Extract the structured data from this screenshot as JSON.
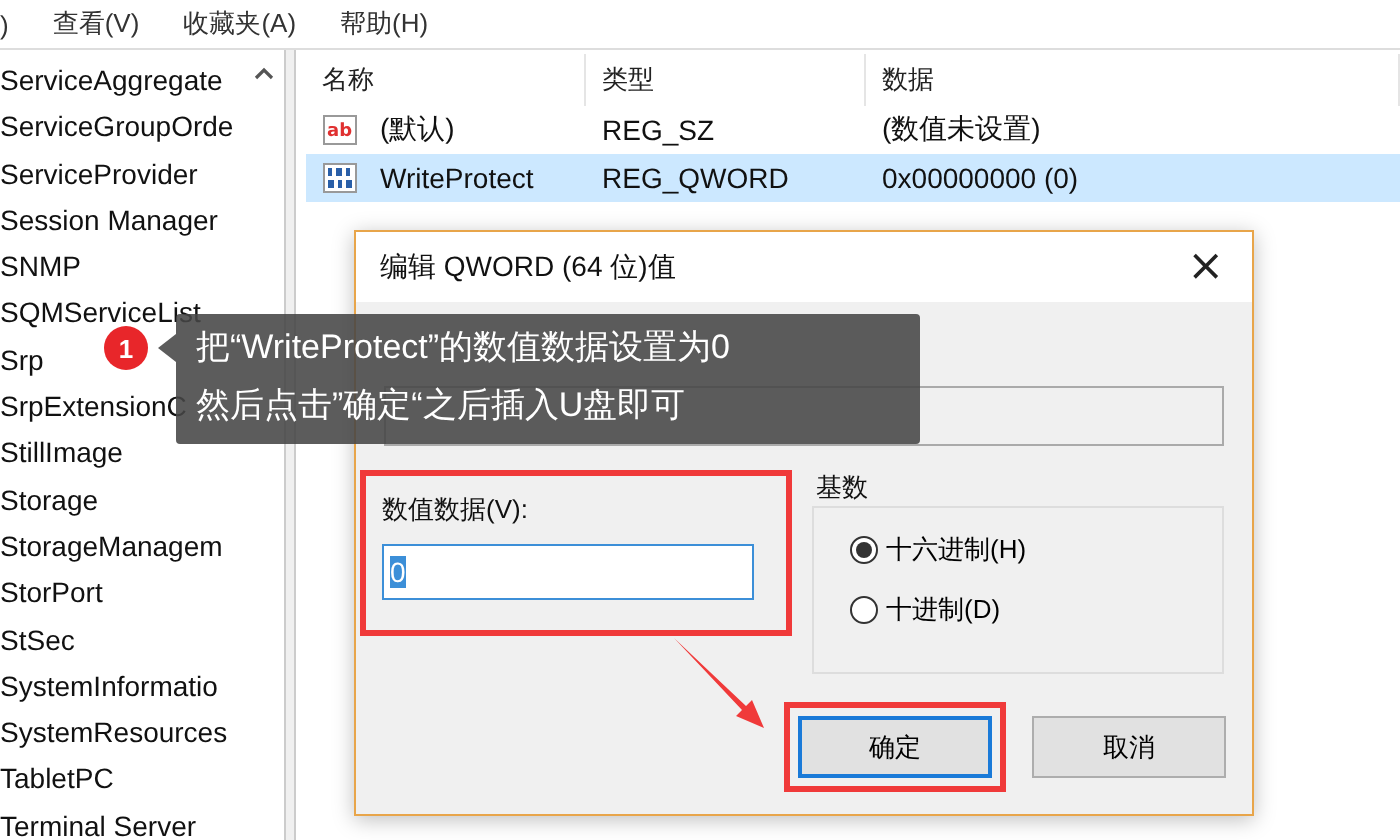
{
  "menu": [
    ")",
    "查看(V)",
    "收藏夹(A)",
    "帮助(H)"
  ],
  "tree": {
    "items": [
      "ServiceAggregate",
      "ServiceGroupOrde",
      "ServiceProvider",
      "Session Manager",
      "SNMP",
      "SQMServiceList",
      "Srp",
      "SrpExtensionC",
      "StillImage",
      "Storage",
      "StorageManagem",
      "StorPort",
      "StSec",
      "SystemInformatio",
      "SystemResources",
      "TabletPC",
      "Terminal Server"
    ]
  },
  "table": {
    "columns": [
      "名称",
      "类型",
      "数据"
    ],
    "rows": [
      {
        "kind": "string",
        "icon": "ab",
        "selected": false,
        "cells": [
          "(默认)",
          "REG_SZ",
          "(数值未设置)"
        ]
      },
      {
        "kind": "binary",
        "selected": true,
        "cells": [
          "WriteProtect",
          "REG_QWORD",
          "0x00000000 (0)"
        ]
      }
    ]
  },
  "dialog": {
    "title": "编辑 QWORD (64 位)值",
    "close": "×",
    "value": {
      "label": "数值数据(V):",
      "value": "0",
      "highlighted": true
    },
    "base": {
      "label": "基数",
      "options": [
        {
          "label": "十六进制(H)",
          "selected": true
        },
        {
          "label": "十进制(D)",
          "selected": false
        }
      ]
    },
    "buttons": [
      {
        "label": "确定",
        "default": true,
        "highlighted": true
      },
      {
        "label": "取消",
        "default": false,
        "highlighted": false
      }
    ]
  },
  "callout": {
    "number": "1",
    "lines": [
      "把“WriteProtect”的数值数据设置为0",
      "然后点击”确定“之后插入U盘即可"
    ]
  }
}
